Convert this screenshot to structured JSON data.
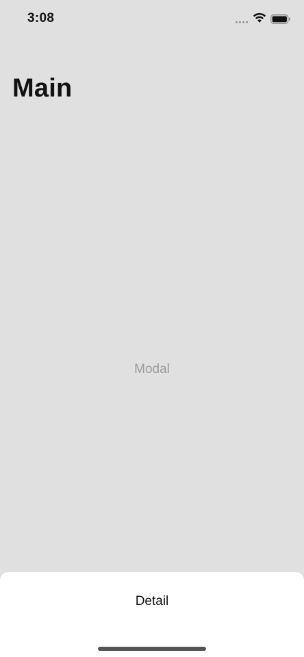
{
  "status_bar": {
    "time": "3:08",
    "icons": [
      "signal-dots-icon",
      "wifi-icon",
      "battery-icon"
    ]
  },
  "nav": {
    "title": "Main"
  },
  "main": {
    "placeholder_label": "Modal"
  },
  "sheet": {
    "label": "Detail"
  },
  "colors": {
    "background": "#e0e0e0",
    "sheet": "#ffffff",
    "text_primary": "#111111",
    "text_secondary": "#9a9a9a"
  }
}
